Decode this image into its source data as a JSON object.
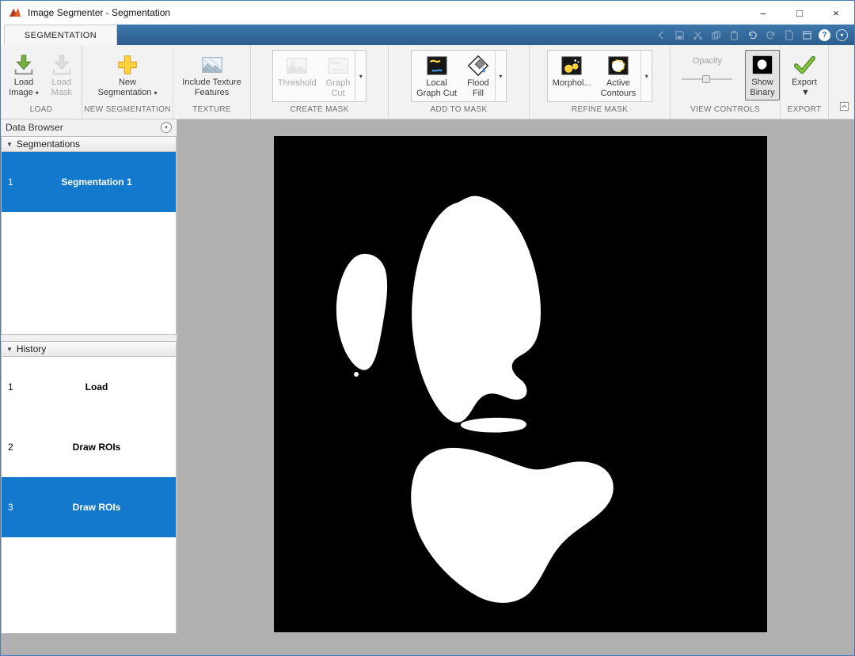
{
  "window": {
    "title": "Image Segmenter - Segmentation"
  },
  "glyphs": {
    "minimize": "–",
    "maximize": "□",
    "close": "×",
    "dropdown_small": "▾",
    "dropdown_large": "▼",
    "triangle_down": "▼",
    "help": "?",
    "chevron_down": "▾"
  },
  "tab": {
    "label": "SEGMENTATION"
  },
  "ribbon": {
    "sections": [
      {
        "name": "LOAD",
        "buttons": [
          {
            "line1": "Load",
            "line2": "Image",
            "has_dropdown": true,
            "enabled": true
          },
          {
            "line1": "Load",
            "line2": "Mask",
            "enabled": false
          }
        ]
      },
      {
        "name": "NEW SEGMENTATION",
        "buttons": [
          {
            "line1": "New",
            "line2": "Segmentation",
            "has_dropdown": true,
            "enabled": true
          }
        ]
      },
      {
        "name": "TEXTURE",
        "buttons": [
          {
            "line1": "Include Texture",
            "line2": "Features",
            "enabled": true
          }
        ]
      },
      {
        "name": "CREATE MASK",
        "buttons": [
          {
            "line1": "Threshold",
            "line2": "",
            "enabled": false
          },
          {
            "line1": "Graph",
            "line2": "Cut",
            "enabled": false
          }
        ]
      },
      {
        "name": "ADD TO MASK",
        "buttons": [
          {
            "line1": "Local",
            "line2": "Graph Cut",
            "enabled": true
          },
          {
            "line1": "Flood",
            "line2": "Fill",
            "enabled": true
          }
        ]
      },
      {
        "name": "REFINE MASK",
        "buttons": [
          {
            "line1": "Morphol...",
            "line2": "",
            "enabled": true
          },
          {
            "line1": "Active",
            "line2": "Contours",
            "enabled": true
          }
        ]
      },
      {
        "name": "VIEW CONTROLS",
        "opacity_label": "Opacity",
        "buttons": [
          {
            "line1": "Show",
            "line2": "Binary",
            "enabled": true,
            "selected": true
          }
        ]
      },
      {
        "name": "EXPORT",
        "buttons": [
          {
            "line1": "Export",
            "line2": "",
            "has_dropdown": true,
            "enabled": true
          }
        ]
      }
    ]
  },
  "data_browser": {
    "title": "Data Browser",
    "segmentations": {
      "header": "Segmentations",
      "items": [
        {
          "num": "1",
          "label": "Segmentation 1",
          "selected": true
        }
      ]
    },
    "history": {
      "header": "History",
      "items": [
        {
          "num": "1",
          "label": "Load",
          "selected": false
        },
        {
          "num": "2",
          "label": "Draw ROIs",
          "selected": false
        },
        {
          "num": "3",
          "label": "Draw ROIs",
          "selected": true
        }
      ]
    }
  },
  "colors": {
    "selection_blue": "#1279cd",
    "toolstrip_blue": "#2f6496",
    "canvas_gray": "#b0b0b0",
    "mask_background": "#000000",
    "mask_foreground": "#ffffff"
  }
}
